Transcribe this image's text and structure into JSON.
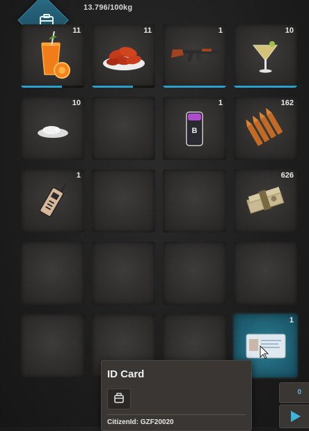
{
  "header": {
    "icon": "backpack-icon",
    "weight": "13.796/100kg"
  },
  "slots": [
    {
      "item": "orange-juice-icon",
      "count": "11",
      "durability": 0.65
    },
    {
      "item": "chicken-wings-icon",
      "count": "11",
      "durability": 0.65
    },
    {
      "item": "assault-rifle-icon",
      "count": "1",
      "durability": 1.0
    },
    {
      "item": "cocktail-icon",
      "count": "10",
      "durability": 1.0
    },
    {
      "item": "powder-pile-icon",
      "count": "10"
    },
    {
      "item": "",
      "count": ""
    },
    {
      "item": "smartphone-icon",
      "count": "1"
    },
    {
      "item": "ammo-rounds-icon",
      "count": "162"
    },
    {
      "item": "radio-icon",
      "count": "1"
    },
    {
      "item": "",
      "count": ""
    },
    {
      "item": "",
      "count": ""
    },
    {
      "item": "cash-stack-icon",
      "count": "626"
    },
    {
      "item": "",
      "count": ""
    },
    {
      "item": "",
      "count": ""
    },
    {
      "item": "",
      "count": ""
    },
    {
      "item": "",
      "count": ""
    },
    {
      "item": "",
      "count": ""
    },
    {
      "item": "",
      "count": ""
    },
    {
      "item": "",
      "count": ""
    },
    {
      "item": "id-card-icon",
      "count": "1",
      "selected": true
    }
  ],
  "tooltip": {
    "title": "ID Card",
    "icon": "id-card-small-icon",
    "citizen_line": "CitizenId: GZF20020"
  },
  "side_panel": {
    "value": "0",
    "action_icon": "play-arrow-icon"
  },
  "colors": {
    "accent": "#2aa0cf",
    "selected_slot": "#1e5f72"
  }
}
